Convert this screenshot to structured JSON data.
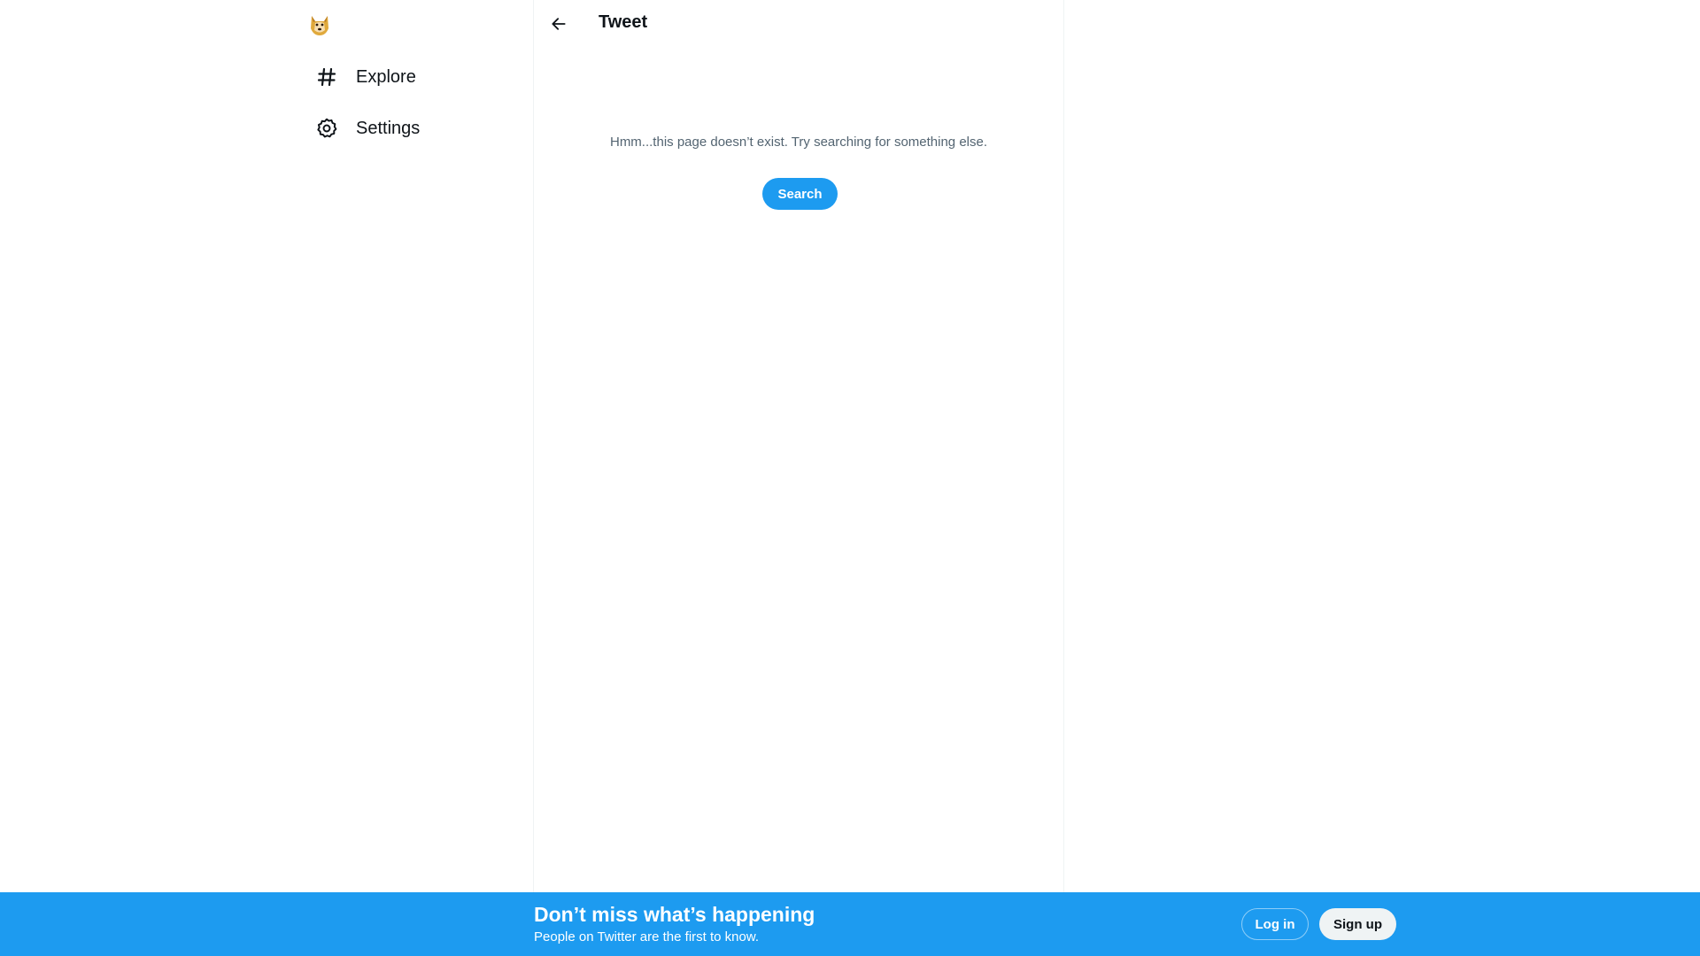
{
  "sidebar": {
    "logo_icon": "doge-logo-icon",
    "items": [
      {
        "label": "Explore",
        "icon": "hashtag-icon"
      },
      {
        "label": "Settings",
        "icon": "gear-icon"
      }
    ]
  },
  "main": {
    "title": "Tweet",
    "back_icon": "arrow-left-icon",
    "empty_message": "Hmm...this page doesn’t exist. Try searching for something else.",
    "search_label": "Search"
  },
  "banner": {
    "title": "Don’t miss what’s happening",
    "subtitle": "People on Twitter are the first to know.",
    "login_label": "Log in",
    "signup_label": "Sign up"
  },
  "colors": {
    "accent": "#1d9bf0",
    "text_primary": "#0f1419",
    "text_secondary": "#536471",
    "border": "#eff3f4"
  }
}
